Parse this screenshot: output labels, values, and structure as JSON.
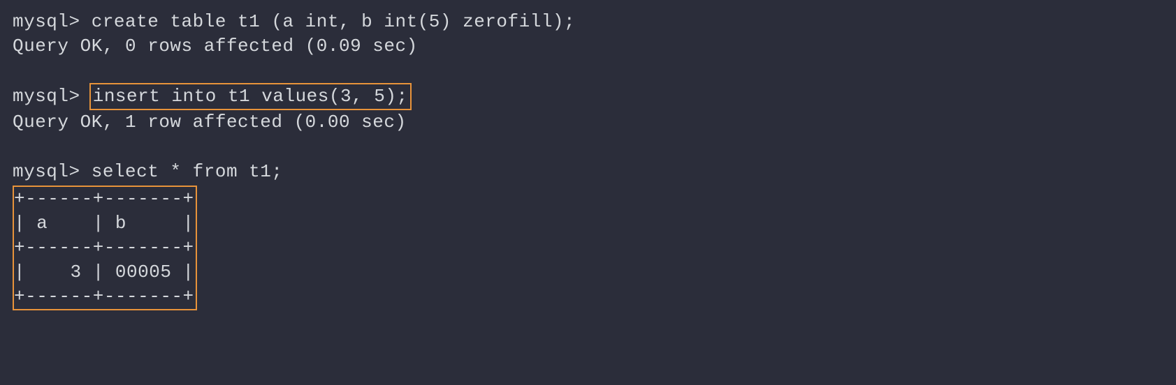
{
  "terminal": {
    "prompt": "mysql> ",
    "cmd1": "create table t1 (a int, b int(5) zerofill);",
    "result1": "Query OK, 0 rows affected (0.09 sec)",
    "cmd2": "insert into t1 values(3, 5);",
    "result2": "Query OK, 1 row affected (0.00 sec)",
    "cmd3": "select * from t1;",
    "table": {
      "border": "+------+-------+",
      "header": "| a    | b     |",
      "row1": "|    3 | 00005 |"
    }
  }
}
